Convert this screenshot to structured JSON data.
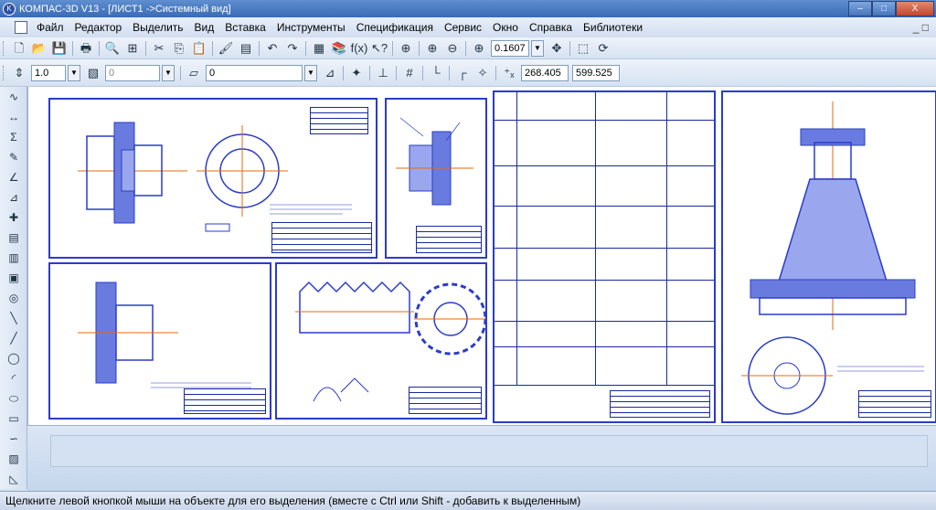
{
  "window": {
    "title": "КОМПАС-3D V13 - [ЛИСТ1 ->Системный вид]",
    "minimize": "–",
    "maximize": "□",
    "close": "X"
  },
  "menu": {
    "items": [
      "Файл",
      "Редактор",
      "Выделить",
      "Вид",
      "Вставка",
      "Инструменты",
      "Спецификация",
      "Сервис",
      "Окно",
      "Справка",
      "Библиотеки"
    ],
    "mdi_min": "_ □"
  },
  "toolbar_standard": {
    "zoom_value": "0.1607"
  },
  "toolbar_current_state": {
    "step_value": "1.0",
    "layer_value": "0",
    "view_value": "0",
    "coord_x": "268.405",
    "coord_y": "599.525"
  },
  "status": {
    "hint": "Щелкните левой кнопкой мыши на объекте для его выделения (вместе с Ctrl или Shift - добавить к выделенным)"
  },
  "colors": {
    "drawing_line": "#2a3cc8",
    "axis_line": "#e06b10",
    "hatch": "#1a2aa0"
  }
}
